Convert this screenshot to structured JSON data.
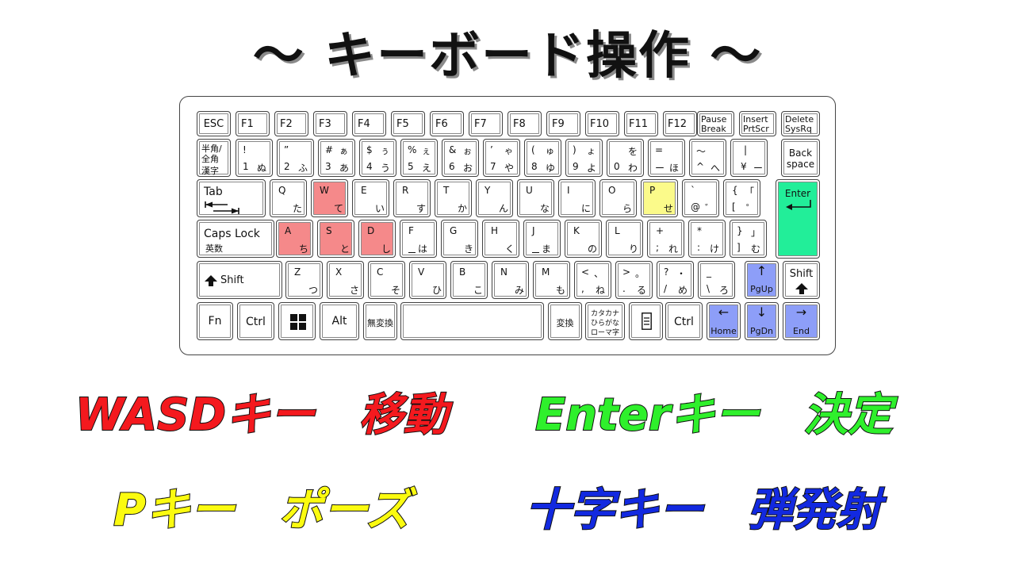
{
  "title": "〜 キーボード操作 〜",
  "colors": {
    "wasd": "#f5898a",
    "pause": "#fbfa8a",
    "enter": "#22ee99",
    "arrows": "#8d9ef8",
    "caption_red": "#f4191e",
    "caption_green": "#2ff02c",
    "caption_yellow": "#fbfb10",
    "caption_blue": "#1229e0"
  },
  "keys": {
    "esc": "ESC",
    "f1": "F1",
    "f2": "F2",
    "f3": "F3",
    "f4": "F4",
    "f5": "F5",
    "f6": "F6",
    "f7": "F7",
    "f8": "F8",
    "f9": "F9",
    "f10": "F10",
    "f11": "F11",
    "f12": "F12",
    "pause_1": "Pause",
    "pause_2": "Break",
    "insert_1": "Insert",
    "insert_2": "PrtScr",
    "delete_1": "Delete",
    "delete_2": "SysRq",
    "hankaku_1": "半角/",
    "hankaku_2": "全角",
    "hankaku_3": "漢字",
    "n1_sym": "!",
    "n1_num": "1",
    "n1_kana": "ぬ",
    "n2_sym": "”",
    "n2_num": "2",
    "n2_kana": "ふ",
    "n3_sym": "#",
    "n3_skana": "ぁ",
    "n3_num": "3",
    "n3_kana": "あ",
    "n4_sym": "$",
    "n4_skana": "ぅ",
    "n4_num": "4",
    "n4_kana": "う",
    "n5_sym": "%",
    "n5_skana": "ぇ",
    "n5_num": "5",
    "n5_kana": "え",
    "n6_sym": "&",
    "n6_skana": "ぉ",
    "n6_num": "6",
    "n6_kana": "お",
    "n7_sym": "’",
    "n7_skana": "ゃ",
    "n7_num": "7",
    "n7_kana": "や",
    "n8_sym": "(",
    "n8_skana": "ゅ",
    "n8_num": "8",
    "n8_kana": "ゆ",
    "n9_sym": ")",
    "n9_skana": "ょ",
    "n9_num": "9",
    "n9_kana": "よ",
    "n0_skana": "を",
    "n0_num": "0",
    "n0_kana": "わ",
    "minus_sym": "=",
    "minus_num": "ー",
    "minus_kana": "ほ",
    "caret_sym": "〜",
    "caret_num": "^",
    "caret_kana": "へ",
    "yen_sym": "|",
    "yen_num": "¥",
    "yen_kana": "ー",
    "back_1": "Back",
    "back_2": "space",
    "tab": "Tab",
    "q": "Q",
    "q_kana": "た",
    "w": "W",
    "w_kana": "て",
    "e": "E",
    "e_kana": "い",
    "r": "R",
    "r_kana": "す",
    "t": "T",
    "t_kana": "か",
    "y": "Y",
    "y_kana": "ん",
    "u": "U",
    "u_kana": "な",
    "i": "I",
    "i_kana": "に",
    "o": "O",
    "o_kana": "ら",
    "p": "P",
    "p_kana": "せ",
    "at_sym": "`",
    "at_num": "@",
    "at_kana": "゛",
    "bracket_sym": "{",
    "bracket_skana": "「",
    "bracket_num": "[",
    "bracket_kana": "゜",
    "enter": "Enter",
    "caps_1": "Caps Lock",
    "caps_2": "英数",
    "a": "A",
    "a_kana": "ち",
    "s": "S",
    "s_kana": "と",
    "d": "D",
    "d_kana": "し",
    "f": "F",
    "f_kana": "は",
    "g": "G",
    "g_kana": "き",
    "h": "H",
    "h_kana": "く",
    "j": "J",
    "j_kana": "ま",
    "k": "K",
    "k_kana": "の",
    "l": "L",
    "l_kana": "り",
    "semi_sym": "+",
    "semi_num": ";",
    "semi_kana": "れ",
    "colon_sym": "*",
    "colon_num": ":",
    "colon_kana": "け",
    "rbr_sym": "}",
    "rbr_skana": "」",
    "rbr_num": "]",
    "rbr_kana": "む",
    "shift_l": "Shift",
    "z": "Z",
    "z_kana": "つ",
    "x": "X",
    "x_kana": "さ",
    "c": "C",
    "c_kana": "そ",
    "v": "V",
    "v_kana": "ひ",
    "b": "B",
    "b_kana": "こ",
    "n": "N",
    "n_kana": "み",
    "m": "M",
    "m_kana": "も",
    "comma_sym": "<",
    "comma_skana": "、",
    "comma_num": ",",
    "comma_kana": "ね",
    "period_sym": ">",
    "period_skana": "。",
    "period_num": ".",
    "period_kana": "る",
    "slash_sym": "?",
    "slash_skana": "・",
    "slash_num": "/",
    "slash_kana": "め",
    "bslash_sym": "_",
    "bslash_num": "\\",
    "bslash_kana": "ろ",
    "pgup": "PgUp",
    "shift_r": "Shift",
    "fn": "Fn",
    "ctrl_l": "Ctrl",
    "alt": "Alt",
    "muhenkan": "無変換",
    "henkan": "変換",
    "kana_1": "カタカナ",
    "kana_2": "ひらがな",
    "kana_3": "ローマ字",
    "ctrl_r": "Ctrl",
    "home": "Home",
    "pgdn": "PgDn",
    "end": "End"
  },
  "captions": {
    "wasd": "WASDキー　移動",
    "enter": "Enterキー　決定",
    "pause": "Pキー　ポーズ",
    "arrows": "十字キー　弾発射"
  }
}
